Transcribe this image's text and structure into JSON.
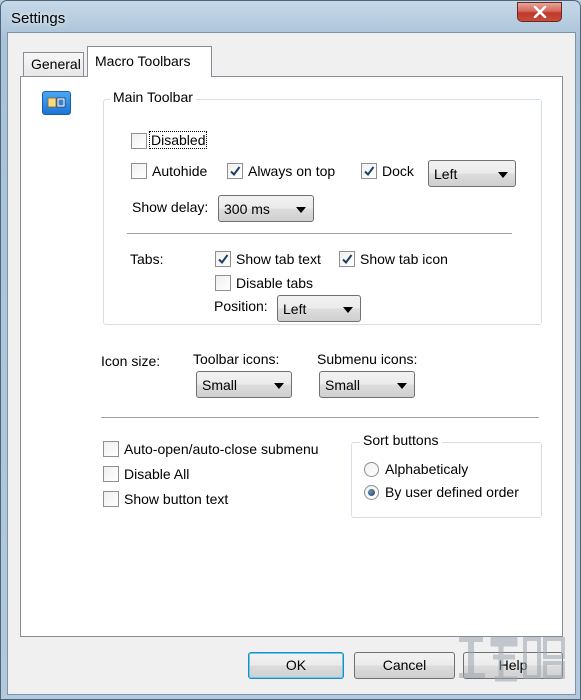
{
  "window": {
    "title": "Settings"
  },
  "tabs": [
    {
      "label": "General",
      "selected": false
    },
    {
      "label": "Macro Toolbars",
      "selected": true
    }
  ],
  "main_toolbar": {
    "group_title": "Main Toolbar",
    "disabled": {
      "label": "Disabled",
      "checked": false
    },
    "autohide": {
      "label": "Autohide",
      "checked": false
    },
    "always_on_top": {
      "label": "Always on top",
      "checked": true
    },
    "dock": {
      "label": "Dock",
      "checked": true,
      "value": "Left"
    },
    "show_delay": {
      "label": "Show delay:",
      "value": "300 ms"
    },
    "tabs_label": "Tabs:",
    "show_tab_text": {
      "label": "Show tab text",
      "checked": true
    },
    "show_tab_icon": {
      "label": "Show tab icon",
      "checked": true
    },
    "disable_tabs": {
      "label": "Disable tabs",
      "checked": false
    },
    "position": {
      "label": "Position:",
      "value": "Left"
    }
  },
  "icon_size": {
    "label": "Icon size:",
    "toolbar_icons": {
      "label": "Toolbar icons:",
      "value": "Small"
    },
    "submenu_icons": {
      "label": "Submenu icons:",
      "value": "Small"
    }
  },
  "options": {
    "auto_open": {
      "label": "Auto-open/auto-close submenu",
      "checked": false
    },
    "disable_all": {
      "label": "Disable All",
      "checked": false
    },
    "show_button_text": {
      "label": "Show button text",
      "checked": false
    }
  },
  "sort_buttons": {
    "group_title": "Sort buttons",
    "alphabetically": {
      "label": "Alphabeticaly",
      "selected": false
    },
    "user_defined": {
      "label": "By user defined order",
      "selected": true
    }
  },
  "footer": {
    "ok": "OK",
    "cancel": "Cancel",
    "help": "Help"
  },
  "colors": {
    "accent": "#3c7fb1",
    "check": "#1d3f63",
    "panel": "#ffffff",
    "dialog": "#f0f0f0"
  },
  "icons": {
    "close": "close-icon",
    "dropdown": "chevron-down-icon",
    "check": "check-icon",
    "preview": "toolbar-preview-icon"
  }
}
